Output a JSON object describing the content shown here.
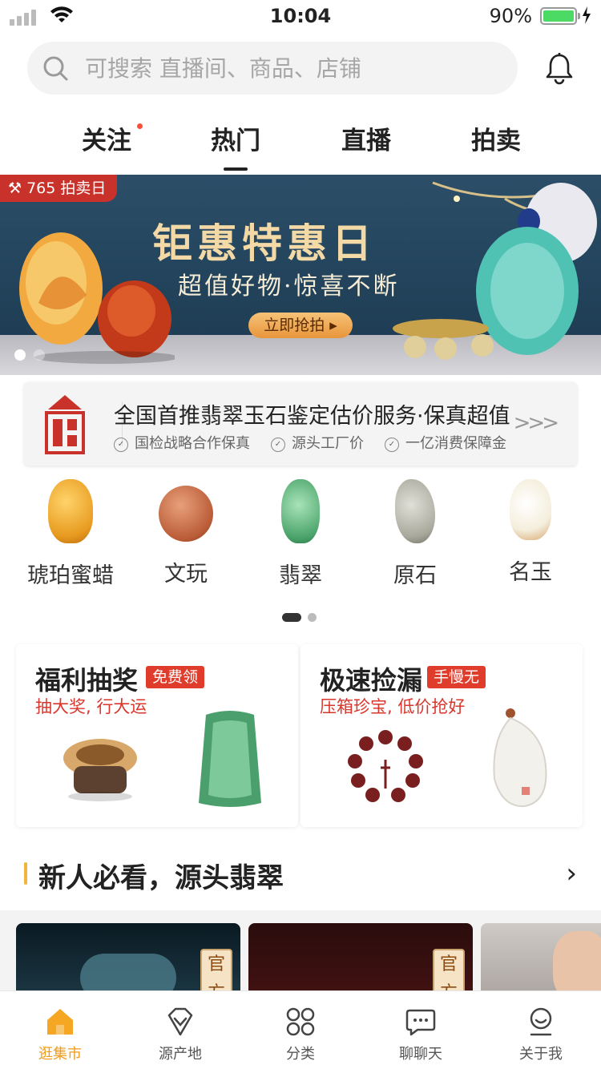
{
  "status": {
    "time": "10:04",
    "battery": "90%"
  },
  "search": {
    "placeholder": "可搜索 直播间、商品、店铺"
  },
  "tabs": [
    {
      "label": "关注"
    },
    {
      "label": "热门"
    },
    {
      "label": "直播"
    },
    {
      "label": "拍卖"
    }
  ],
  "banner": {
    "tag": "765 拍卖日",
    "title": "钜惠特惠日",
    "subtitle": "超值好物·惊喜不断",
    "cta": "立即抢拍 ▸"
  },
  "promo": {
    "headline": "全国首推翡翠玉石鉴定估价服务·保真超值",
    "checks": [
      "国检战略合作保真",
      "源头工厂价",
      "一亿消费保障金"
    ]
  },
  "categories": [
    {
      "label": "琥珀蜜蜡"
    },
    {
      "label": "文玩"
    },
    {
      "label": "翡翠"
    },
    {
      "label": "原石"
    },
    {
      "label": "名玉"
    }
  ],
  "cards": {
    "left": {
      "title": "福利抽奖",
      "badge": "免费领",
      "subtitle": "抽大奖, 行大运"
    },
    "right": {
      "title": "极速捡漏",
      "badge": "手慢无",
      "subtitle": "压箱珍宝, 低价抢好"
    }
  },
  "section": {
    "title": "新人必看，源头翡翠"
  },
  "products": {
    "official_tag": "官方"
  },
  "nav": [
    {
      "label": "逛集市",
      "icon": "home-icon"
    },
    {
      "label": "源产地",
      "icon": "gem-icon"
    },
    {
      "label": "分类",
      "icon": "grid-icon"
    },
    {
      "label": "聊聊天",
      "icon": "chat-icon"
    },
    {
      "label": "关于我",
      "icon": "profile-icon"
    }
  ],
  "colors": {
    "accent": "#f29b1a",
    "red": "#e03c2b"
  }
}
